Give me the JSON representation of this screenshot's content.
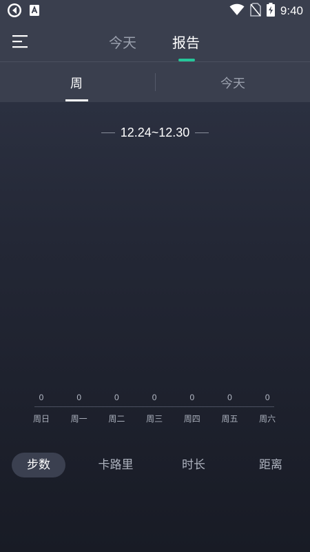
{
  "status_bar": {
    "time": "9:40"
  },
  "app_bar": {
    "tabs": [
      {
        "label": "今天"
      },
      {
        "label": "报告"
      }
    ]
  },
  "sub_tabs": [
    {
      "label": "周"
    },
    {
      "label": "今天"
    }
  ],
  "date_range": "12.24~12.30",
  "chart_data": {
    "type": "bar",
    "categories": [
      "周日",
      "周一",
      "周二",
      "周三",
      "周四",
      "周五",
      "周六"
    ],
    "values": [
      0,
      0,
      0,
      0,
      0,
      0,
      0
    ],
    "value_labels": [
      "0",
      "0",
      "0",
      "0",
      "0",
      "0",
      "0"
    ],
    "title": "",
    "xlabel": "",
    "ylabel": ""
  },
  "metric_tabs": [
    {
      "label": "步数",
      "active": true
    },
    {
      "label": "卡路里",
      "active": false
    },
    {
      "label": "时长",
      "active": false
    },
    {
      "label": "距离",
      "active": false
    }
  ],
  "colors": {
    "accent": "#25c79a",
    "bar_bg": "#3a3f4e"
  }
}
